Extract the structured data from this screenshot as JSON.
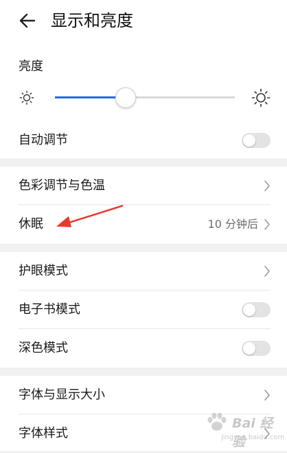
{
  "header": {
    "title": "显示和亮度"
  },
  "brightness": {
    "label": "亮度",
    "level_percent": 39
  },
  "auto_adjust": {
    "label": "自动调节",
    "on": false
  },
  "color": {
    "label": "色彩调节与色温"
  },
  "sleep": {
    "label": "休眠",
    "value": "10 分钟后"
  },
  "eye_comfort": {
    "label": "护眼模式"
  },
  "ebook": {
    "label": "电子书模式",
    "on": false
  },
  "dark": {
    "label": "深色模式",
    "on": false
  },
  "font_size": {
    "label": "字体与显示大小"
  },
  "font_style": {
    "label": "字体样式"
  },
  "watermark": {
    "brand": "Bai 经验",
    "site": "jingyan.baidu.com"
  },
  "colors": {
    "accent": "#1e6ee6",
    "annotation": "#e8392f",
    "background": "#f1f1f1"
  },
  "icons": {
    "back": "back-arrow-icon",
    "sun": "sun-icon",
    "chevron": "chevron-right-icon"
  }
}
